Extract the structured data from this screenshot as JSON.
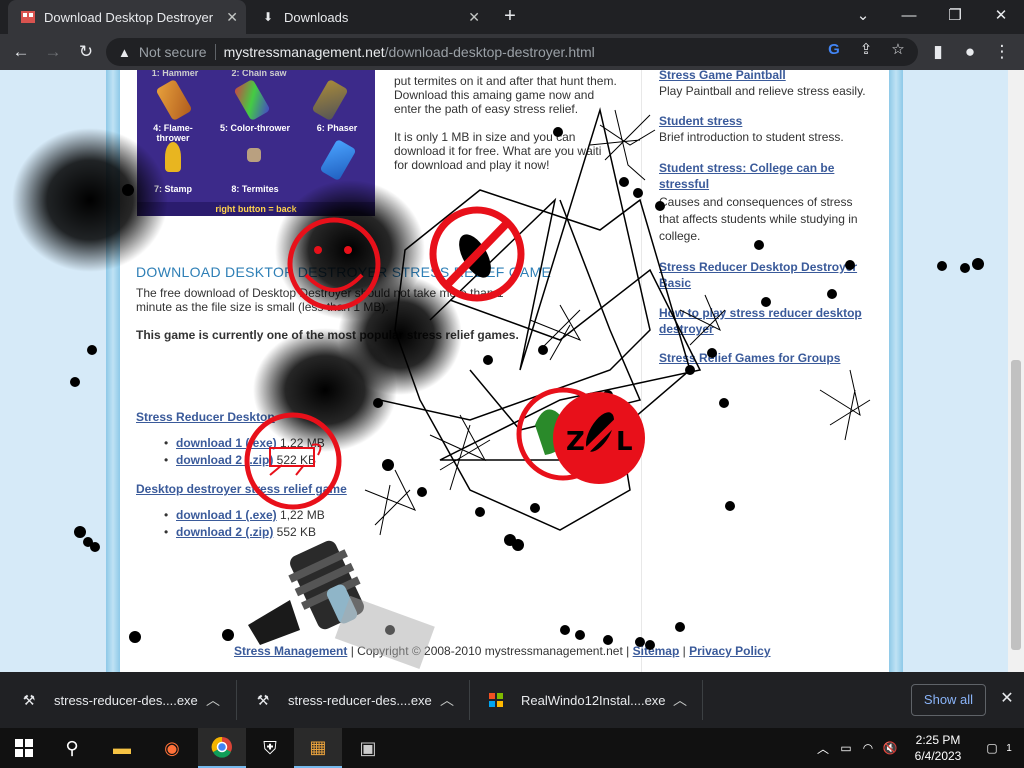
{
  "browser": {
    "tabs": [
      {
        "title": "Download Desktop Destroyer",
        "favicon": "site-favicon",
        "active": true
      },
      {
        "title": "Downloads",
        "favicon": "download-icon",
        "active": false
      }
    ],
    "new_tab": "+",
    "window_controls": {
      "dropdown": "⌄",
      "minimize": "—",
      "restore": "❐",
      "close": "✕"
    },
    "security_label": "Not secure",
    "url_host": "mystressmanagement.net",
    "url_path": "/download-desktop-destroyer.html"
  },
  "page": {
    "game_items": [
      {
        "label": "4: Flame-thrower"
      },
      {
        "label": "5: Color-thrower"
      },
      {
        "label": "6: Phaser"
      },
      {
        "label": "7: Stamp"
      },
      {
        "label": "8: Termites"
      },
      {
        "label": ""
      }
    ],
    "game_top_labels": [
      "1: Hammer",
      "2: Chain saw"
    ],
    "right_button": "right button = back",
    "intro_lines": [
      "put termites on it and after that hunt them.",
      "Download this amaing game now and",
      "enter the path of easy stress relief."
    ],
    "size_lines": [
      "It is only 1 MB in size and you can",
      "download it for free. What are you waiti",
      "for download and play it now!"
    ],
    "download_heading": "DOWNLOAD DESKTOP DESTROYER STRESS RELIEF GAME",
    "download_text_1": "The free download of Desktop Destroyer should not take more than 1",
    "download_text_2": "minute as the file size is small (less than 1 MB).",
    "popular_text": "This game is currently one of the most popular stress relief games.",
    "section1_title": "Stress Reducer Desktop",
    "section1_links": [
      {
        "label": "download 1 (.exe)",
        "size": "1,22 MB"
      },
      {
        "label": "download 2 (.zip)",
        "size": "522 KB"
      }
    ],
    "section2_title": "Desktop destroyer stress relief game",
    "section2_links": [
      {
        "label": "download 1 (.exe)",
        "size": "1,22 MB"
      },
      {
        "label": "download 2 (.zip)",
        "size": "552 KB"
      }
    ],
    "sidebar": [
      {
        "title": "Stress Game Paintball",
        "desc": "Play Paintball and relieve stress easily."
      },
      {
        "title": "Student stress",
        "desc": "Brief introduction to student stress."
      },
      {
        "title": "Student stress: College can be stressful",
        "desc": "Causes and consequences of stress that affects students while studying in college."
      },
      {
        "title": "Stress Reducer Desktop Destroyer Basic",
        "desc": ""
      },
      {
        "title": "How to play stress reducer desktop destroyer",
        "desc": ""
      },
      {
        "title": "Stress Relief Games for Groups",
        "desc": ""
      }
    ],
    "footer": {
      "link1": "Stress Management",
      "copyright": "| Copyright © 2008-2010 mystressmanagement.net |",
      "link2": "Sitemap",
      "sep": "|",
      "link3": "Privacy Policy"
    }
  },
  "downloads": [
    {
      "name": "stress-reducer-des....exe",
      "icon": "executable-icon"
    },
    {
      "name": "stress-reducer-des....exe",
      "icon": "executable-icon"
    },
    {
      "name": "RealWindo12Instal....exe",
      "icon": "installer-icon"
    }
  ],
  "show_all": "Show all",
  "taskbar": {
    "time": "2:25 PM",
    "date": "6/4/2023",
    "notification_count": "1"
  },
  "colors": {
    "link": "#3a5a9a",
    "heading": "#2e7fb6",
    "tab_bar": "#202124",
    "toolbar": "#35363a"
  }
}
